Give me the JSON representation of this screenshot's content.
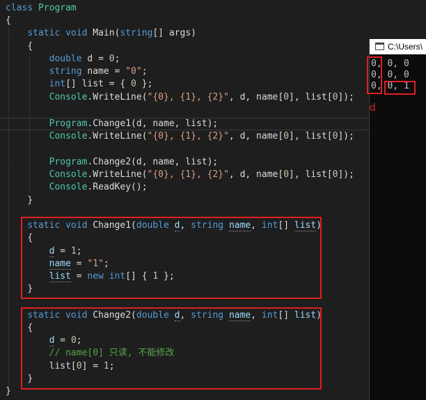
{
  "code": {
    "class_kw": "class",
    "class_name": "Program",
    "brace_open": "{",
    "brace_close": "}",
    "static_kw": "static",
    "void_kw": "void",
    "main_name": "Main",
    "string_kw": "string",
    "double_kw": "double",
    "int_kw": "int",
    "new_kw": "new",
    "main_params": "[] args)",
    "line_d_decl": " d = ",
    "zero": "0",
    "one": "1",
    "line_name_decl": " name = ",
    "str_zero": "\"0\"",
    "str_one": "\"1\"",
    "line_list_decl": "[] list = { ",
    "close_init": " };",
    "semicolon": ";",
    "console": "Console",
    "writeline_call": ".WriteLine(",
    "fmt": "\"{0}, {1}, {2}\"",
    "writeline_args": ", d, name[",
    "writeline_args2": "], list[",
    "writeline_end": "]);",
    "program": "Program",
    "change1_call": ".Change1(d, name, list);",
    "change2_call": ".Change2(d, name, list);",
    "readkey_call": ".ReadKey();",
    "change1_name": "Change1(",
    "change2_name": "Change2(",
    "param_d": "d",
    "param_name": "name",
    "param_list": "list",
    "comma": ", ",
    "brackets": "[] ",
    "close_paren": ")",
    "assign_d": " = ",
    "assign_list_new": " = ",
    "list_init_tail": "[] { ",
    "comment": "// name[0] 只读, 不能修改",
    "list_index_assign": "list[",
    "list_index_assign2": "] = "
  },
  "console_window": {
    "title": "C:\\Users\\",
    "lines": [
      "0, 0, 0",
      "0, 0, 0",
      "0, 0, 1"
    ]
  },
  "annotation": {
    "d_label": "d"
  }
}
